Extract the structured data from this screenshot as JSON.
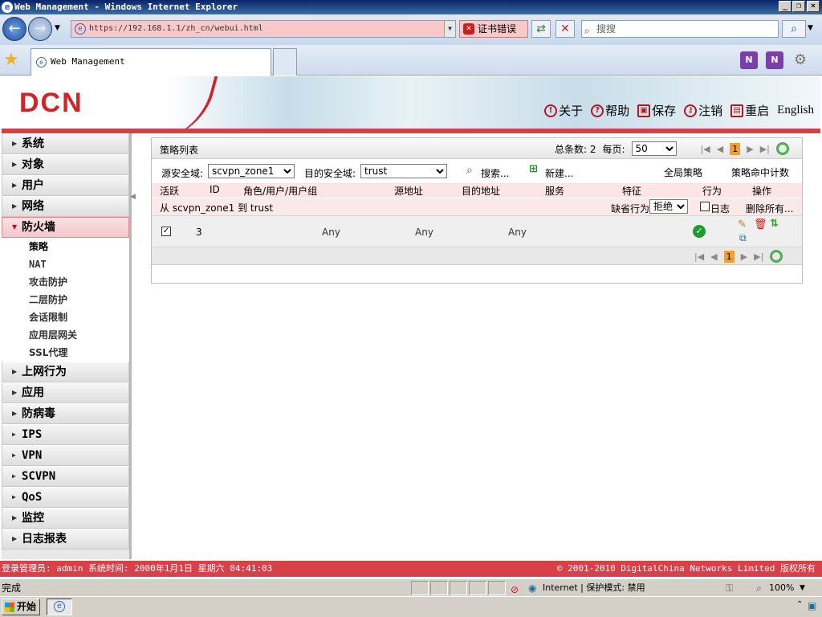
{
  "window": {
    "title": "Web Management - Windows Internet Explorer"
  },
  "browser": {
    "url": "https://192.168.1.1/zh_cn/webui.html",
    "cert_error": "证书错误",
    "search_placeholder": "搜搜",
    "tab_title": "Web Management"
  },
  "header": {
    "logo": "DCN",
    "nav": [
      {
        "icon": "info-icon",
        "glyph": "!",
        "label": "关于"
      },
      {
        "icon": "help-icon",
        "glyph": "?",
        "label": "帮助"
      },
      {
        "icon": "save-icon",
        "glyph": "▣",
        "label": "保存"
      },
      {
        "icon": "key-icon",
        "glyph": "⚷",
        "label": "注销"
      },
      {
        "icon": "restart-icon",
        "glyph": "▤",
        "label": "重启"
      },
      {
        "icon": "",
        "glyph": "",
        "label": "English"
      }
    ]
  },
  "sidebar": {
    "items": [
      {
        "label": "系统"
      },
      {
        "label": "对象"
      },
      {
        "label": "用户"
      },
      {
        "label": "网络"
      }
    ],
    "active": {
      "label": "防火墙"
    },
    "sub_items": [
      {
        "label": "策略"
      },
      {
        "label": "NAT"
      },
      {
        "label": "攻击防护"
      },
      {
        "label": "二层防护"
      },
      {
        "label": "会话限制"
      },
      {
        "label": "应用层网关"
      },
      {
        "label": "SSL代理"
      }
    ],
    "items_after": [
      {
        "label": "上网行为"
      },
      {
        "label": "应用"
      },
      {
        "label": "防病毒"
      },
      {
        "label": "IPS"
      },
      {
        "label": "VPN"
      },
      {
        "label": "SCVPN"
      },
      {
        "label": "QoS"
      },
      {
        "label": "监控"
      },
      {
        "label": "日志报表"
      }
    ]
  },
  "panel": {
    "title": "策略列表",
    "total_label": "总条数: 2",
    "per_page_label": "每页:",
    "per_page_value": "50",
    "page": "1",
    "source_zone_label": "源安全域:",
    "source_zone_value": "scvpn_zone1",
    "dest_zone_label": "目的安全域:",
    "dest_zone_value": "trust",
    "search_label": "搜索...",
    "new_label": "新建...",
    "global_policy": "全局策略",
    "hit_count": "策略命中计数",
    "columns": [
      "活跃",
      "ID",
      "角色/用户/用户组",
      "源地址",
      "目的地址",
      "服务",
      "特征",
      "行为",
      "操作"
    ],
    "zone_row": {
      "text": "从 scvpn_zone1 到 trust",
      "default_action_label": "缺省行为",
      "default_action_value": "拒绝",
      "log_label": "日志",
      "delete_all": "删除所有..."
    },
    "rows": [
      {
        "active": "✓",
        "id": "3",
        "src": "Any",
        "dst": "Any",
        "svc": "Any"
      }
    ]
  },
  "statusbar": {
    "left": "登录管理员: admin 系统时间: 2000年1月1日 星期六 04:41:03",
    "right": "© 2001-2010 DigitalChina Networks Limited 版权所有"
  },
  "ie_status": {
    "text": "完成",
    "zone": "Internet | 保护模式: 禁用",
    "zoom": "100%"
  },
  "taskbar": {
    "start": "开始"
  }
}
